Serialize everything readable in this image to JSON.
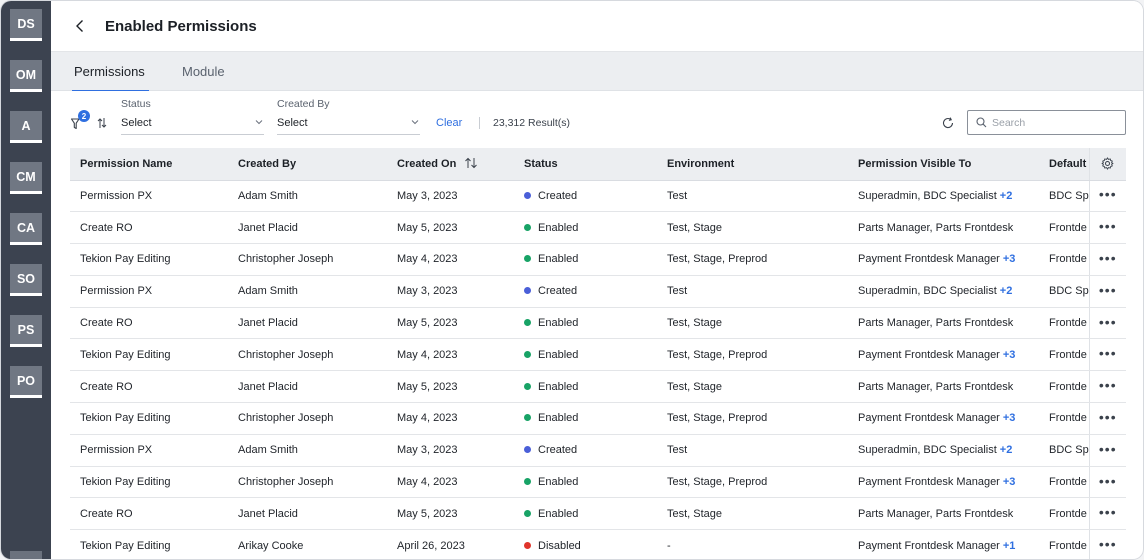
{
  "rail": {
    "items": [
      {
        "label": "DS"
      },
      {
        "label": "OM"
      },
      {
        "label": "A"
      },
      {
        "label": "CM"
      },
      {
        "label": "CA"
      },
      {
        "label": "SO"
      },
      {
        "label": "PS"
      },
      {
        "label": "PO"
      }
    ]
  },
  "header": {
    "title": "Enabled Permissions",
    "back_icon": "chevron-left-icon"
  },
  "tabs": [
    {
      "label": "Permissions",
      "active": true
    },
    {
      "label": "Module",
      "active": false
    }
  ],
  "filters": {
    "filter_badge": "2",
    "status": {
      "label": "Status",
      "value": "Select"
    },
    "created_by": {
      "label": "Created By",
      "value": "Select"
    },
    "clear_label": "Clear",
    "results": "23,312 Result(s)",
    "search_placeholder": "Search"
  },
  "colors": {
    "accent": "#2f6fe0",
    "created": "#4a5fd8",
    "enabled": "#18a366",
    "disabled": "#e0352b"
  },
  "table": {
    "columns": [
      "Permission Name",
      "Created By",
      "Created On",
      "Status",
      "Environment",
      "Permission Visible To",
      "Default"
    ],
    "rows": [
      {
        "name": "Permission PX",
        "created_by": "Adam Smith",
        "created_on": "May 3, 2023",
        "status": "Created",
        "status_key": "created",
        "env": "Test",
        "visible": "Superadmin, BDC Specialist",
        "extra": "+2",
        "default": "BDC Sp"
      },
      {
        "name": "Create RO",
        "created_by": "Janet Placid",
        "created_on": "May 5, 2023",
        "status": "Enabled",
        "status_key": "enabled",
        "env": "Test, Stage",
        "visible": "Parts Manager, Parts Frontdesk",
        "extra": "",
        "default": "Frontde"
      },
      {
        "name": "Tekion Pay Editing",
        "created_by": "Christopher Joseph",
        "created_on": "May 4, 2023",
        "status": "Enabled",
        "status_key": "enabled",
        "env": "Test, Stage, Preprod",
        "visible": "Payment Frontdesk Manager",
        "extra": "+3",
        "default": "Frontde"
      },
      {
        "name": "Permission PX",
        "created_by": "Adam Smith",
        "created_on": "May 3, 2023",
        "status": "Created",
        "status_key": "created",
        "env": "Test",
        "visible": "Superadmin, BDC Specialist",
        "extra": "+2",
        "default": "BDC Sp"
      },
      {
        "name": "Create RO",
        "created_by": "Janet Placid",
        "created_on": "May 5, 2023",
        "status": "Enabled",
        "status_key": "enabled",
        "env": "Test, Stage",
        "visible": "Parts Manager, Parts Frontdesk",
        "extra": "",
        "default": "Frontde"
      },
      {
        "name": "Tekion Pay Editing",
        "created_by": "Christopher Joseph",
        "created_on": "May 4, 2023",
        "status": "Enabled",
        "status_key": "enabled",
        "env": "Test, Stage, Preprod",
        "visible": "Payment Frontdesk Manager",
        "extra": "+3",
        "default": "Frontde"
      },
      {
        "name": "Create RO",
        "created_by": "Janet Placid",
        "created_on": "May 5, 2023",
        "status": "Enabled",
        "status_key": "enabled",
        "env": "Test, Stage",
        "visible": "Parts Manager, Parts Frontdesk",
        "extra": "",
        "default": "Frontde"
      },
      {
        "name": "Tekion Pay Editing",
        "created_by": "Christopher Joseph",
        "created_on": "May 4, 2023",
        "status": "Enabled",
        "status_key": "enabled",
        "env": "Test, Stage, Preprod",
        "visible": "Payment Frontdesk Manager",
        "extra": "+3",
        "default": "Frontde"
      },
      {
        "name": "Permission PX",
        "created_by": "Adam Smith",
        "created_on": "May 3, 2023",
        "status": "Created",
        "status_key": "created",
        "env": "Test",
        "visible": "Superadmin, BDC Specialist",
        "extra": "+2",
        "default": "BDC Sp"
      },
      {
        "name": "Tekion Pay Editing",
        "created_by": "Christopher Joseph",
        "created_on": "May 4, 2023",
        "status": "Enabled",
        "status_key": "enabled",
        "env": "Test, Stage, Preprod",
        "visible": "Payment Frontdesk Manager",
        "extra": "+3",
        "default": "Frontde"
      },
      {
        "name": "Create RO",
        "created_by": "Janet Placid",
        "created_on": "May 5, 2023",
        "status": "Enabled",
        "status_key": "enabled",
        "env": "Test, Stage",
        "visible": "Parts Manager, Parts Frontdesk",
        "extra": "",
        "default": "Frontde"
      },
      {
        "name": "Tekion Pay Editing",
        "created_by": "Arikay Cooke",
        "created_on": "April 26, 2023",
        "status": "Disabled",
        "status_key": "disabled",
        "env": "-",
        "visible": "Payment Frontdesk Manager",
        "extra": "+1",
        "default": "Frontde"
      }
    ]
  }
}
